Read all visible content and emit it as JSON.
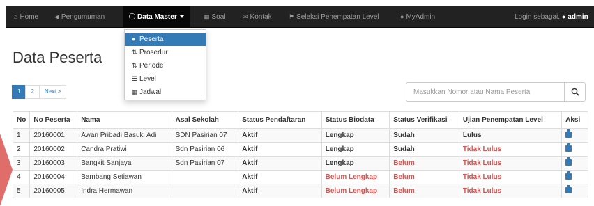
{
  "navbar": {
    "items": [
      {
        "label": "Home",
        "icon": "home-icon"
      },
      {
        "label": "Pengumuman",
        "icon": "bullhorn-icon"
      },
      {
        "label": "Data Master",
        "icon": "info-icon",
        "active": true
      },
      {
        "label": "Soal",
        "icon": "image-icon"
      },
      {
        "label": "Kontak",
        "icon": "envelope-icon"
      },
      {
        "label": "Seleksi Penempatan Level",
        "icon": "flag-icon"
      },
      {
        "label": "MyAdmin",
        "icon": "user-icon"
      }
    ],
    "login_prefix": "Login sebagai,",
    "login_user": "admin"
  },
  "dropdown": {
    "items": [
      {
        "label": "Peserta",
        "icon": "user-icon",
        "active": true
      },
      {
        "label": "Prosedur",
        "icon": "sort-icon"
      },
      {
        "label": "Periode",
        "icon": "sort-icon"
      },
      {
        "label": "Level",
        "icon": "list-icon"
      },
      {
        "label": "Jadwal",
        "icon": "calendar-icon"
      }
    ]
  },
  "page": {
    "title": "Data Peserta"
  },
  "pagination": {
    "pages": [
      "1",
      "2"
    ],
    "next": "Next >"
  },
  "search": {
    "placeholder": "Masukkan Nomor atau Nama Peserta"
  },
  "table": {
    "headers": [
      "No",
      "No Peserta",
      "Nama",
      "Asal Sekolah",
      "Status Pendaftaran",
      "Status Biodata",
      "Status Verifikasi",
      "Ujian Penempatan Level",
      "Aksi"
    ],
    "rows": [
      {
        "no": "1",
        "id": "20160001",
        "nama": "Awan Pribadi Basuki Adi",
        "sekolah": "SDN Pasirian 07",
        "daftar": "Aktif",
        "biodata": "Lengkap",
        "verif": "Sudah",
        "ujian": "Lulus"
      },
      {
        "no": "2",
        "id": "20160002",
        "nama": "Candra Pratiwi",
        "sekolah": "Sdn Pasirian 06",
        "daftar": "Aktif",
        "biodata": "Lengkap",
        "verif": "Sudah",
        "ujian": "Tidak Lulus"
      },
      {
        "no": "3",
        "id": "20160003",
        "nama": "Bangkit Sanjaya",
        "sekolah": "Sdn Pasirian 07",
        "daftar": "Aktif",
        "biodata": "Lengkap",
        "verif": "Belum",
        "ujian": "Tidak Lulus"
      },
      {
        "no": "4",
        "id": "20160004",
        "nama": "Bambang Setiawan",
        "sekolah": "",
        "daftar": "Aktif",
        "biodata": "Belum Lengkap",
        "verif": "Belum",
        "ujian": "Tidak Lulus"
      },
      {
        "no": "5",
        "id": "20160005",
        "nama": "Indra Hermawan",
        "sekolah": "",
        "daftar": "Aktif",
        "biodata": "Belum Lengkap",
        "verif": "Belum",
        "ujian": "Tidak Lulus"
      }
    ]
  },
  "colors": {
    "navbar": "#222222",
    "accent": "#337ab7",
    "danger": "#d9534f"
  }
}
